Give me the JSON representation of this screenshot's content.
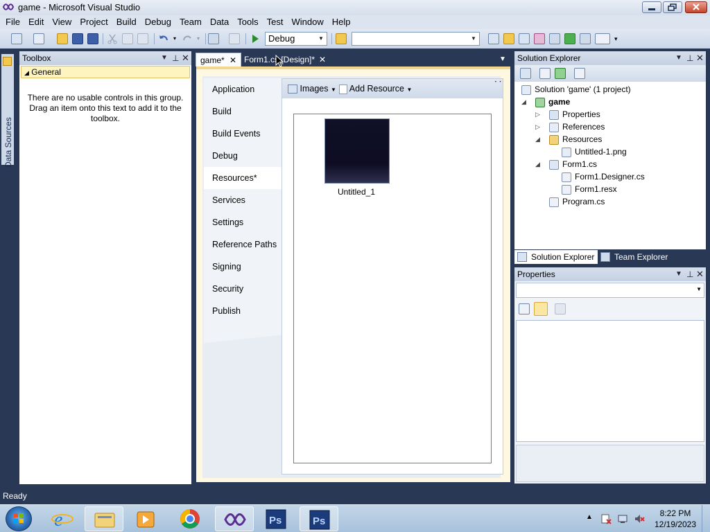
{
  "window": {
    "title": "game - Microsoft Visual Studio"
  },
  "menu": [
    "File",
    "Edit",
    "View",
    "Project",
    "Build",
    "Debug",
    "Team",
    "Data",
    "Tools",
    "Test",
    "Window",
    "Help"
  ],
  "toolbar": {
    "config_value": "Debug",
    "platform_value": ""
  },
  "side_strip": {
    "data_sources_label": "Data Sources"
  },
  "toolbox": {
    "title": "Toolbox",
    "group_label": "General",
    "empty_message": "There are no usable controls in this group. Drag an item onto this text to add it to the toolbox."
  },
  "doc_tabs": [
    {
      "label": "game*",
      "active": true
    },
    {
      "label": "Form1.cs [Design]*",
      "active": false
    }
  ],
  "project_props": {
    "tabs": [
      "Application",
      "Build",
      "Build Events",
      "Debug",
      "Resources*",
      "Services",
      "Settings",
      "Reference Paths",
      "Signing",
      "Security",
      "Publish"
    ],
    "selected_tab": "Resources*",
    "resources_toolbar": {
      "category_label": "Images",
      "add_label": "Add Resource"
    },
    "resource_items": [
      {
        "label": "Untitled_1"
      }
    ]
  },
  "solution_explorer": {
    "title": "Solution Explorer",
    "tree": [
      {
        "label": "Solution 'game' (1 project)",
        "depth": 0
      },
      {
        "label": "game",
        "depth": 1,
        "bold": true,
        "expander": "open"
      },
      {
        "label": "Properties",
        "depth": 2,
        "expander": "closed"
      },
      {
        "label": "References",
        "depth": 2,
        "expander": "closed"
      },
      {
        "label": "Resources",
        "depth": 2,
        "expander": "open"
      },
      {
        "label": "Untitled-1.png",
        "depth": 3
      },
      {
        "label": "Form1.cs",
        "depth": 2,
        "expander": "open"
      },
      {
        "label": "Form1.Designer.cs",
        "depth": 3
      },
      {
        "label": "Form1.resx",
        "depth": 3
      },
      {
        "label": "Program.cs",
        "depth": 2
      }
    ],
    "bottom_tabs": [
      "Solution Explorer",
      "Team Explorer"
    ]
  },
  "properties": {
    "title": "Properties",
    "object_value": ""
  },
  "status": {
    "text": "Ready"
  },
  "taskbar": {
    "apps": [
      "internet-explorer-icon",
      "file-explorer-icon",
      "media-player-icon",
      "chrome-icon",
      "visual-studio-icon",
      "photoshop-icon",
      "photoshop-icon"
    ],
    "clock_time": "8:22 PM",
    "clock_date": "12/19/2023"
  },
  "colors": {
    "chrome_dark": "#293955",
    "toolbox_group": "#fdf4bf",
    "doc_accent": "#f5d68f"
  }
}
